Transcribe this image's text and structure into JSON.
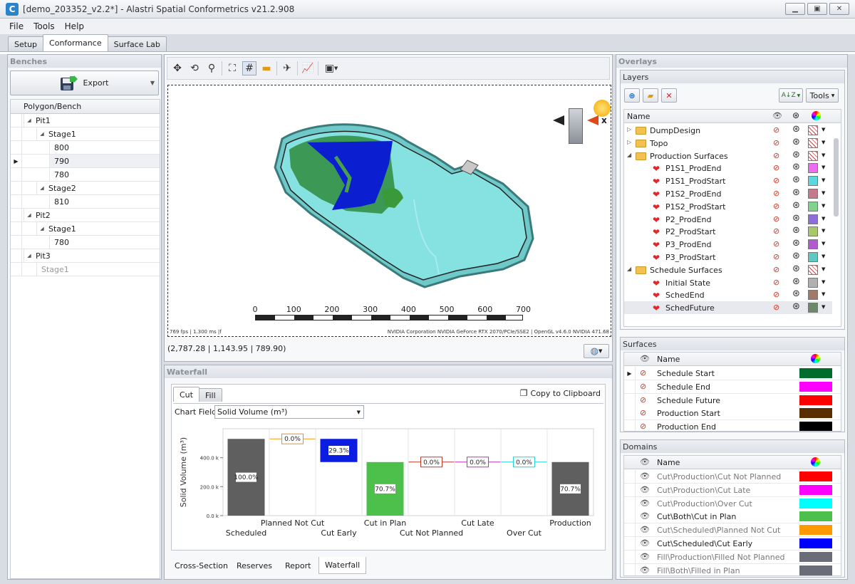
{
  "window": {
    "title": "[demo_203352_v2.2*] - Alastri Spatial Conformetrics v21.2.908",
    "icon": "app-logo-icon",
    "controls": [
      "minimize-icon",
      "maximize-icon",
      "close-icon"
    ],
    "control_glyphs": [
      "▁",
      "▣",
      "✕"
    ]
  },
  "menu": [
    "File",
    "Tools",
    "Help"
  ],
  "tabs": [
    {
      "label": "Setup"
    },
    {
      "label": "Conformance",
      "active": true
    },
    {
      "label": "Surface Lab"
    }
  ],
  "benches": {
    "title": "Benches",
    "export_label": "Export",
    "column": "Polygon/Bench",
    "rows": [
      {
        "label": "Pit1",
        "level": 0,
        "expanded": true
      },
      {
        "label": "Stage1",
        "level": 1,
        "expanded": true
      },
      {
        "label": "800",
        "level": 2
      },
      {
        "label": "790",
        "level": 2,
        "current": true
      },
      {
        "label": "780",
        "level": 2
      },
      {
        "label": "Stage2",
        "level": 1,
        "expanded": true
      },
      {
        "label": "810",
        "level": 2
      },
      {
        "label": "Pit2",
        "level": 0,
        "expanded": true
      },
      {
        "label": "Stage1",
        "level": 1,
        "expanded": true
      },
      {
        "label": "780",
        "level": 2
      },
      {
        "label": "Pit3",
        "level": 0,
        "expanded": true
      },
      {
        "label": "Stage1",
        "level": 1,
        "disabled": true
      }
    ]
  },
  "viewport": {
    "toolbar": [
      "pan-icon",
      "orbit-icon",
      "zoom-icon",
      "zoom-extents-icon",
      "grid-icon",
      "ruler-icon",
      "fly-icon",
      "chart-icon",
      "image-icon"
    ],
    "scale_labels": [
      "0",
      "100",
      "200",
      "300",
      "400",
      "500",
      "600",
      "700"
    ],
    "status_left": "769 fps | 1.300 ms |f",
    "status_right": "NVIDIA Corporation NVIDIA GeForce RTX 2070/PCIe/SSE2 | OpenGL v4.6.0 NVIDIA 471.68",
    "axis_label": "x",
    "coords": "(2,787.28 | 1,143.95 | 789.90)"
  },
  "waterfall": {
    "title": "Waterfall",
    "tabs": [
      "Cut",
      "Fill"
    ],
    "copy_label": "Copy to Clipboard",
    "chart_field_label": "Chart Field",
    "chart_field_value": "Solid Volume (m³)",
    "bottom_tabs": [
      {
        "label": "Cross-Section"
      },
      {
        "label": "Reserves"
      },
      {
        "label": "Report"
      },
      {
        "label": "Waterfall",
        "active": true
      }
    ]
  },
  "chart_data": {
    "type": "bar",
    "ylabel": "Solid Volume (m³)",
    "yticks": [
      "0.0 k",
      "200.0 k",
      "400.0 k"
    ],
    "ylim": [
      0,
      600
    ],
    "categories": [
      "Scheduled",
      "Planned Not Cut",
      "Cut Early",
      "Cut in Plan",
      "Cut Not Planned",
      "Cut Late",
      "Over Cut",
      "Production"
    ],
    "bars": [
      {
        "category": "Scheduled",
        "start": 0,
        "end": 530,
        "label": "100.0%",
        "color": "#5f5f5f",
        "label_color": "#5f5f5f"
      },
      {
        "category": "Planned Not Cut",
        "start": 530,
        "end": 530,
        "label": "0.0%",
        "color": "#f39c12",
        "label_color": "#e8950e"
      },
      {
        "category": "Cut Early",
        "start": 370,
        "end": 530,
        "label": "29.3%",
        "color": "#0a1de0",
        "label_color": "#0a1de0"
      },
      {
        "category": "Cut in Plan",
        "start": 0,
        "end": 370,
        "label": "70.7%",
        "color": "#4cc04a",
        "label_color": "#4cc04a"
      },
      {
        "category": "Cut Not Planned",
        "start": 370,
        "end": 370,
        "label": "0.0%",
        "color": "#c0392b",
        "label_color": "#c0392b"
      },
      {
        "category": "Cut Late",
        "start": 370,
        "end": 370,
        "label": "0.0%",
        "color": "#c02fc0",
        "label_color": "#c02fc0"
      },
      {
        "category": "Over Cut",
        "start": 370,
        "end": 370,
        "label": "0.0%",
        "color": "#22d3d3",
        "label_color": "#22d3d3"
      },
      {
        "category": "Production",
        "start": 0,
        "end": 370,
        "label": "70.7%",
        "color": "#5f5f5f",
        "label_color": "#5f5f5f"
      }
    ]
  },
  "overlays": {
    "title": "Overlays",
    "layers_title": "Layers",
    "tools_label": "Tools",
    "name_header": "Name",
    "layers": [
      {
        "name": "DumpDesign",
        "folder": true,
        "level": 0,
        "color": "hatch"
      },
      {
        "name": "Topo",
        "folder": true,
        "level": 0,
        "color": "hatch"
      },
      {
        "name": "Production Surfaces",
        "folder": true,
        "level": 0,
        "expanded": true,
        "color": "hatch"
      },
      {
        "name": "P1S1_ProdEnd",
        "level": 1,
        "color": "#ef6cf0"
      },
      {
        "name": "P1S1_ProdStart",
        "level": 1,
        "color": "#5ad8e0"
      },
      {
        "name": "P1S2_ProdEnd",
        "level": 1,
        "color": "#c47a8a"
      },
      {
        "name": "P1S2_ProdStart",
        "level": 1,
        "color": "#7fd38a"
      },
      {
        "name": "P2_ProdEnd",
        "level": 1,
        "color": "#8e6ed8"
      },
      {
        "name": "P2_ProdStart",
        "level": 1,
        "color": "#a8c86a"
      },
      {
        "name": "P3_ProdEnd",
        "level": 1,
        "color": "#b25ad0"
      },
      {
        "name": "P3_ProdStart",
        "level": 1,
        "color": "#5ec9c0"
      },
      {
        "name": "Schedule Surfaces",
        "folder": true,
        "level": 0,
        "expanded": true,
        "color": "hatch"
      },
      {
        "name": "Initial State",
        "level": 1,
        "color": "#b0b0b0"
      },
      {
        "name": "SchedEnd",
        "level": 1,
        "color": "#a07a6a"
      },
      {
        "name": "SchedFuture",
        "level": 1,
        "color": "#6a8a6a",
        "selected": true
      }
    ],
    "surfaces_title": "Surfaces",
    "surfaces": [
      {
        "name": "Schedule Start",
        "color": "#006d2c",
        "current": true
      },
      {
        "name": "Schedule End",
        "color": "#ff00ff"
      },
      {
        "name": "Schedule Future",
        "color": "#ff0000"
      },
      {
        "name": "Production Start",
        "color": "#5a2d00"
      },
      {
        "name": "Production End",
        "color": "#000000"
      }
    ],
    "domains_title": "Domains",
    "domains": [
      {
        "name": "Cut\\Production\\Cut Not Planned",
        "color": "#ff0000",
        "muted": true
      },
      {
        "name": "Cut\\Production\\Cut Late",
        "color": "#ff00ff",
        "muted": true
      },
      {
        "name": "Cut\\Production\\Over Cut",
        "color": "#00ffff",
        "muted": true
      },
      {
        "name": "Cut\\Both\\Cut in Plan",
        "color": "#4cc04a"
      },
      {
        "name": "Cut\\Scheduled\\Planned Not Cut",
        "color": "#ff9900",
        "muted": true
      },
      {
        "name": "Cut\\Scheduled\\Cut Early",
        "color": "#0000ff"
      },
      {
        "name": "Fill\\Production\\Filled Not Planned",
        "color": "#6a6c78",
        "muted": true
      },
      {
        "name": "Fill\\Both\\Filled in Plan",
        "color": "#6a6c78",
        "muted": true
      }
    ]
  }
}
